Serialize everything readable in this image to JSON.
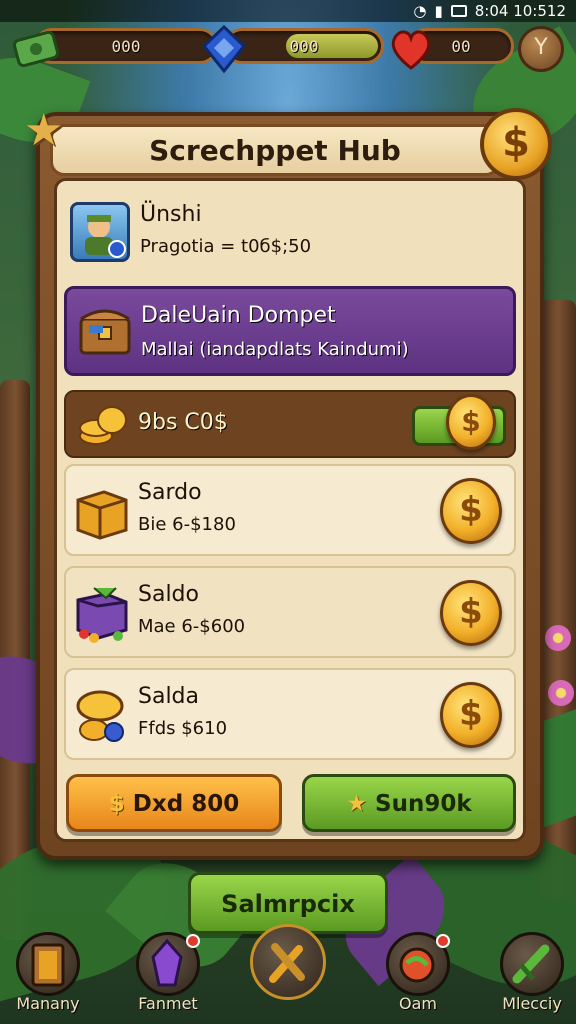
{
  "status_bar": {
    "time": "8:04 10:512"
  },
  "resources": [
    {
      "name": "cash",
      "value": "000",
      "icon": "cash-icon"
    },
    {
      "name": "gems",
      "value": "000",
      "icon": "gem-icon"
    },
    {
      "name": "lives",
      "value": "00",
      "icon": "heart-icon"
    }
  ],
  "panel": {
    "title": "Screchppet Hub",
    "profile": {
      "name": "Ünshi",
      "detail": "Pragotia = t0б$;50"
    },
    "wallet": {
      "title": "DaleUain Dompet",
      "subtitle": "Mallai (iandapdlats Kaindumi)"
    },
    "balance": {
      "value": "9bs C0$"
    },
    "items": [
      {
        "title": "Sardo",
        "price": "Bie 6-$180"
      },
      {
        "title": "Saldo",
        "price": "Mae 6-$600"
      },
      {
        "title": "Salda",
        "price": "Ffds $610"
      }
    ],
    "left_button": "Dxd 800",
    "right_button": "Sun90k"
  },
  "main_button": "Salmrpcix",
  "nav": [
    {
      "label": "Manany",
      "icon": "book-icon"
    },
    {
      "label": "Fanmet",
      "icon": "crystal-icon"
    },
    {
      "label": "",
      "icon": "hammer-icon"
    },
    {
      "label": "Oam",
      "icon": "potion-icon"
    },
    {
      "label": "Mlecciy",
      "icon": "sword-icon"
    }
  ],
  "colors": {
    "purple": "#6a3a8c",
    "orange": "#f0a02a",
    "green": "#7cc23a",
    "gold": "#f2b02a",
    "panel": "#f1e0bc"
  }
}
